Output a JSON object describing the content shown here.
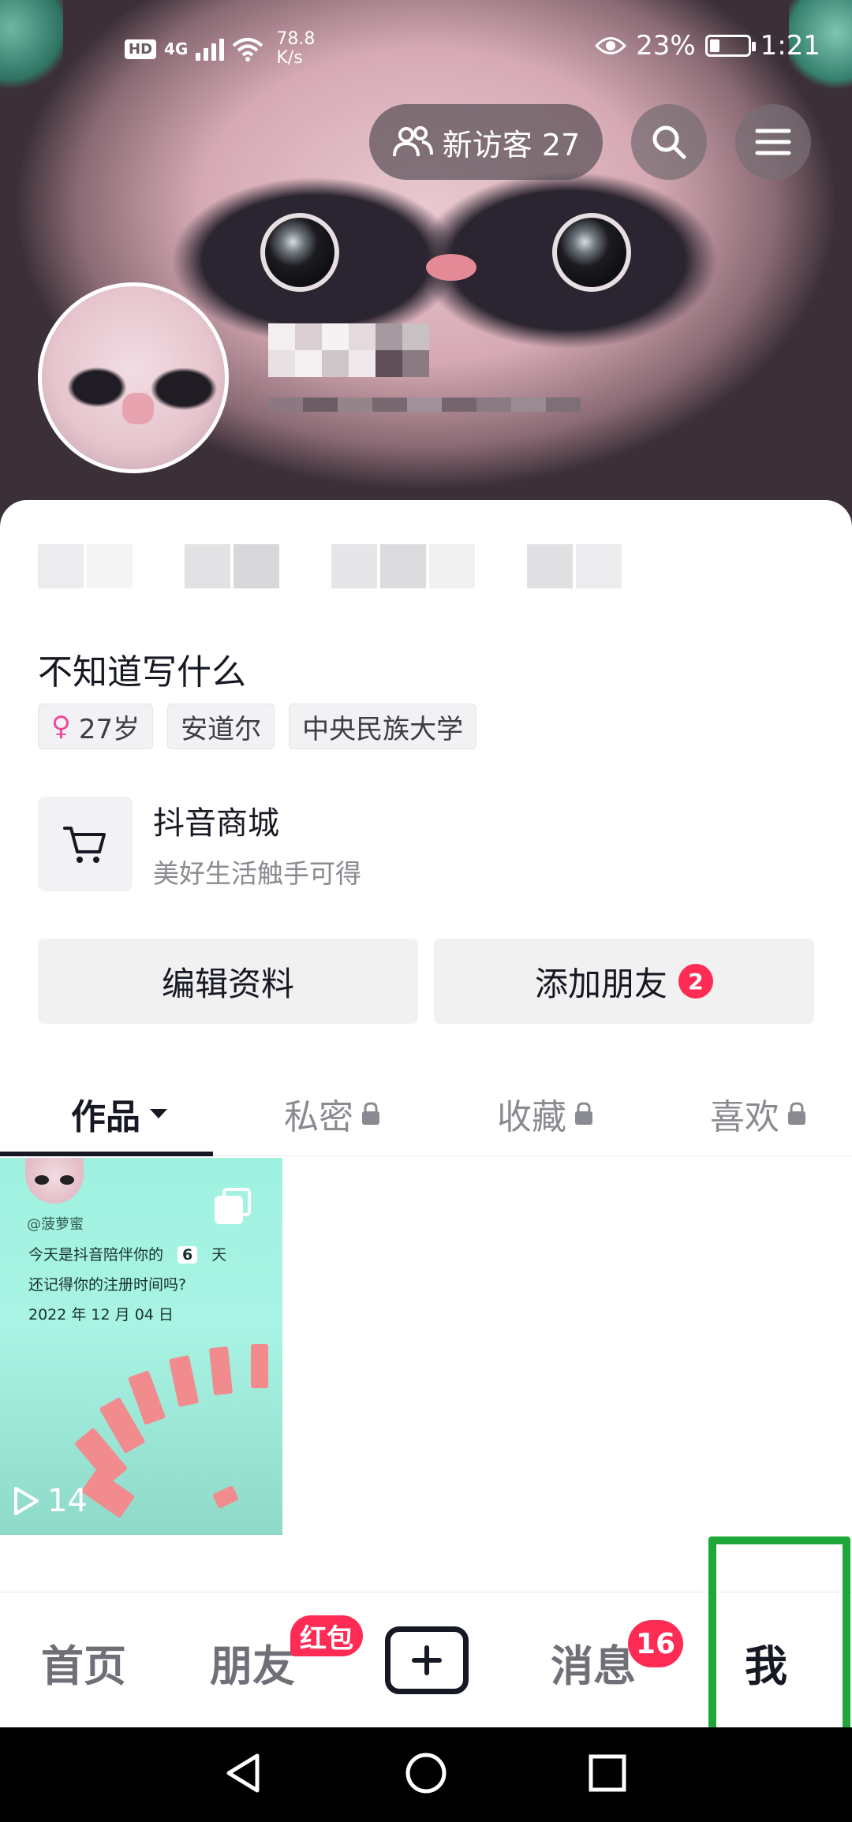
{
  "status_bar": {
    "hd": "HD",
    "network": "4G",
    "speed_value": "78.8",
    "speed_unit": "K/s",
    "battery": "23%",
    "time": "1:21"
  },
  "header": {
    "visitors_label": "新访客 27"
  },
  "profile": {
    "bio": "不知道写什么",
    "tags": {
      "age": "27岁",
      "location": "安道尔",
      "school": "中央民族大学"
    }
  },
  "shop": {
    "title": "抖音商城",
    "subtitle": "美好生活触手可得"
  },
  "actions": {
    "edit_label": "编辑资料",
    "add_friend_label": "添加朋友",
    "add_friend_count": "2"
  },
  "tabs": {
    "works": "作品",
    "private": "私密",
    "favorites": "收藏",
    "likes": "喜欢"
  },
  "video": {
    "handle": "@菠萝蜜",
    "line1_prefix": "今天是抖音陪伴你的",
    "line1_day": "6",
    "line1_suffix": "天",
    "line2": "还记得你的注册时间吗?",
    "line3": "2022 年 12 月 04 日",
    "plays": "14"
  },
  "bottom_nav": {
    "home": "首页",
    "friends": "朋友",
    "friends_badge": "红包",
    "messages": "消息",
    "messages_badge": "16",
    "me": "我"
  },
  "colors": {
    "accent_red": "#fe2c55",
    "highlight_green": "#1fa83a",
    "gender_pink": "#f0489b"
  },
  "icons": {
    "visitors": "people-icon",
    "search": "search-icon",
    "menu": "menu-icon",
    "shop": "cart-icon",
    "gender": "female-icon",
    "lock": "lock-icon",
    "play": "play-icon",
    "multi": "collection-icon"
  }
}
